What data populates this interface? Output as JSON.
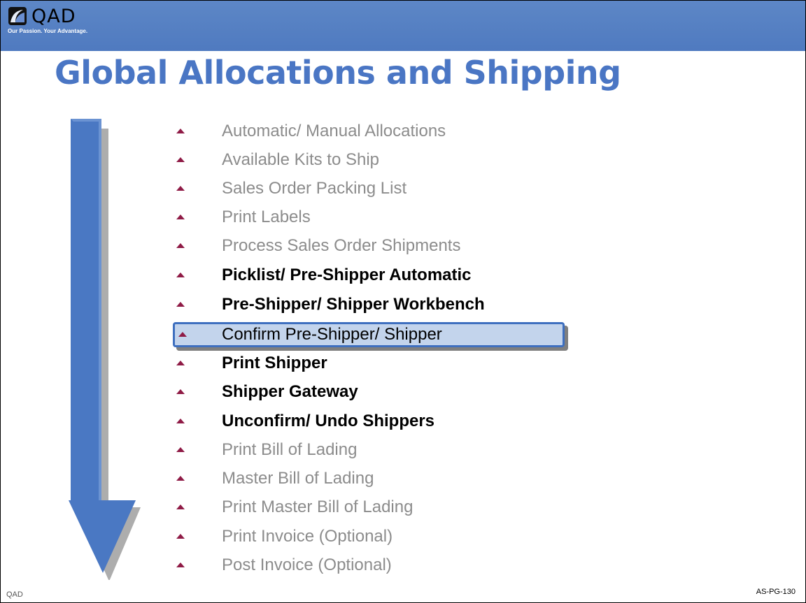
{
  "header": {
    "logo_text": "QAD",
    "tagline": "Our Passion. Your Advantage.",
    "accent_color": "#4f7ac0"
  },
  "title": "Global Allocations and Shipping",
  "items": [
    {
      "label": "Automatic/ Manual Allocations",
      "style": "muted"
    },
    {
      "label": "Available Kits to Ship",
      "style": "muted"
    },
    {
      "label": "Sales Order Packing List",
      "style": "muted"
    },
    {
      "label": "Print Labels",
      "style": "muted"
    },
    {
      "label": "Process Sales Order Shipments",
      "style": "muted"
    },
    {
      "label": "Picklist/ Pre-Shipper Automatic",
      "style": "bold"
    },
    {
      "label": "Pre-Shipper/ Shipper Workbench",
      "style": "bold"
    },
    {
      "label": "Confirm Pre-Shipper/ Shipper",
      "style": "selected"
    },
    {
      "label": "Print Shipper",
      "style": "bold"
    },
    {
      "label": "Shipper Gateway",
      "style": "bold"
    },
    {
      "label": "Unconfirm/ Undo Shippers",
      "style": "bold"
    },
    {
      "label": "Print Bill of Lading",
      "style": "muted"
    },
    {
      "label": "Master Bill of Lading",
      "style": "muted"
    },
    {
      "label": "Print Master Bill of Lading",
      "style": "muted"
    },
    {
      "label": "Print Invoice (Optional)",
      "style": "muted"
    },
    {
      "label": "Post Invoice (Optional)",
      "style": "muted"
    }
  ],
  "icons": {
    "bullet": "triangle-bullet-icon",
    "arrow": "down-arrow-icon",
    "logo": "qad-logo-icon"
  },
  "footer": {
    "left": "QAD",
    "right": "AS-PG-130"
  }
}
